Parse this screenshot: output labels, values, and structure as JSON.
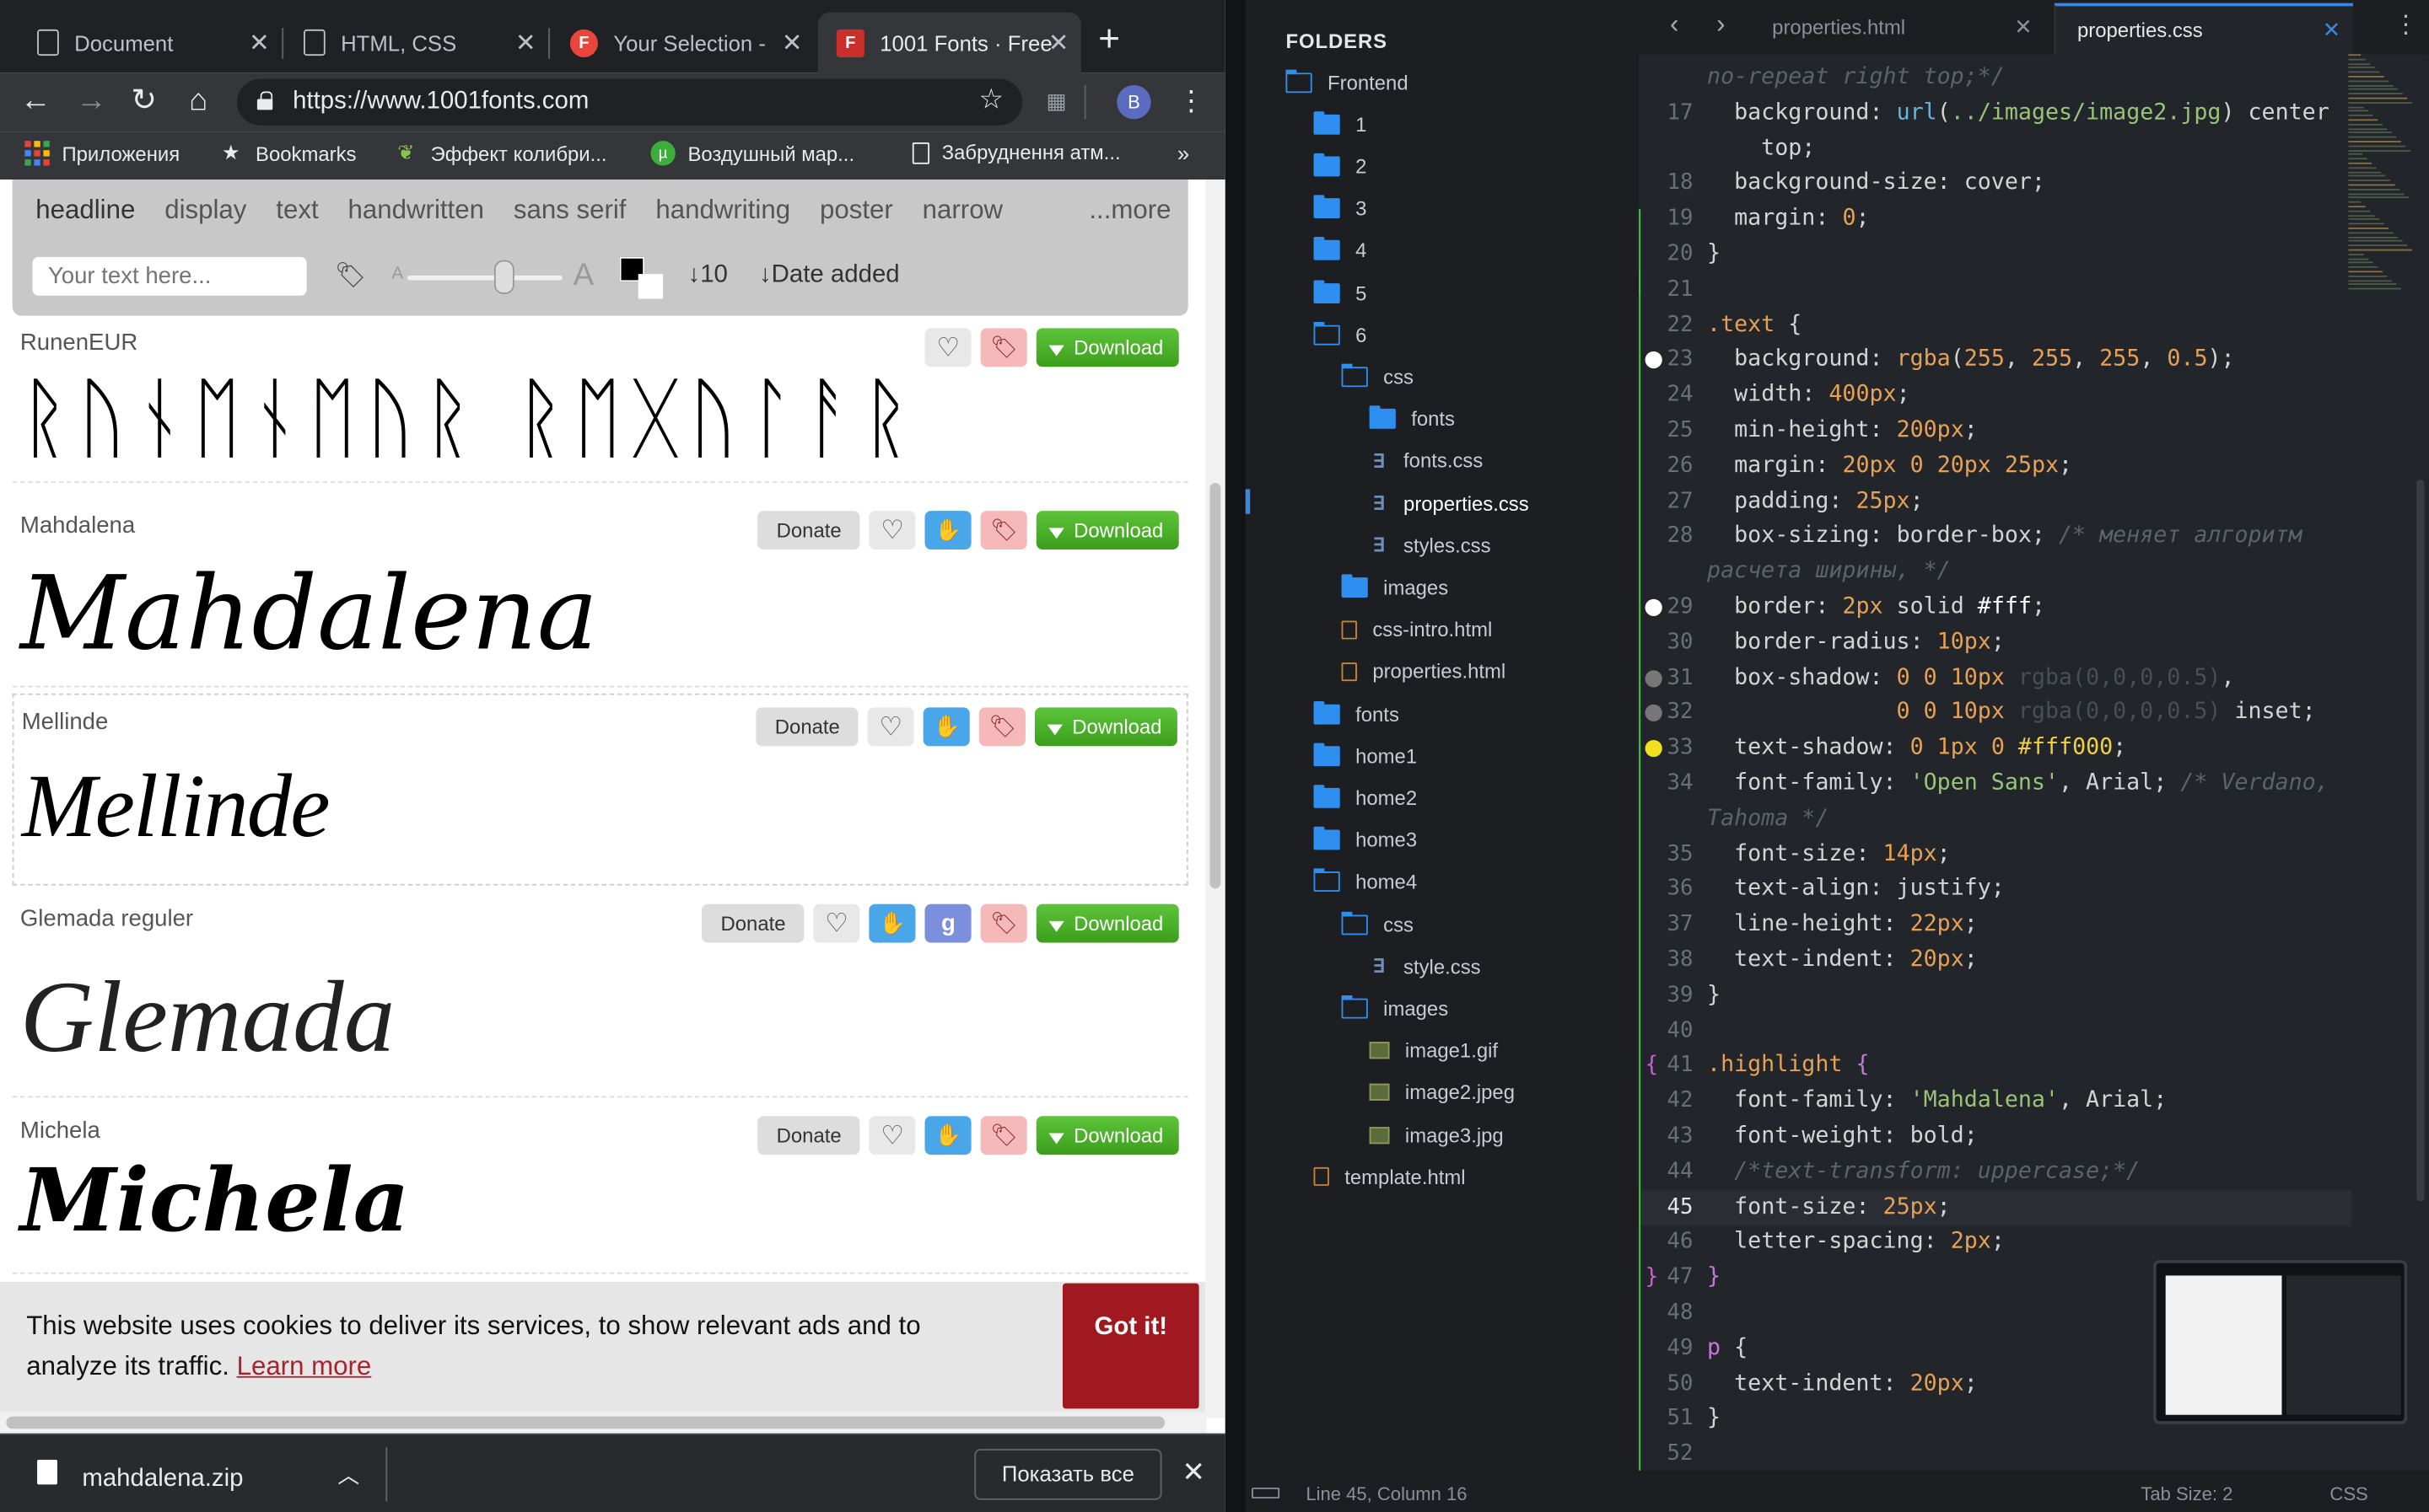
{
  "browser": {
    "tabs": [
      {
        "title": "Document",
        "icon": "doc"
      },
      {
        "title": "HTML, CSS",
        "icon": "doc"
      },
      {
        "title": "Your Selection -",
        "icon": "F"
      },
      {
        "title": "1001 Fonts · Free",
        "icon": "F"
      }
    ],
    "url": "https://www.1001fonts.com",
    "avatar": "B",
    "bookmarks": [
      "Приложения",
      "Bookmarks",
      "Эффект колибри...",
      "Воздушный мар...",
      "Забруднення атм..."
    ],
    "bookmarks_more": "»"
  },
  "page": {
    "categories": [
      "headline",
      "display",
      "text",
      "handwritten",
      "sans serif",
      "handwriting",
      "poster",
      "narrow"
    ],
    "more": "...more",
    "text_placeholder": "Your text here...",
    "size_small": "A",
    "size_large": "A",
    "slider_value": 0.62,
    "sort_count": "↓10",
    "sort_date": "↓Date added",
    "fonts": [
      {
        "name": "RunenEUR",
        "sample": "ᚱᚢᚾᛖᚾᛖᚢᚱ ᚱᛖᚷᚢᛚᚨᚱ",
        "donate": "",
        "download": "Download"
      },
      {
        "name": "Mahdalena",
        "sample": "Mahdalena",
        "donate": "Donate",
        "download": "Download"
      },
      {
        "name": "Mellinde",
        "sample": "Mellinde",
        "donate": "Donate",
        "download": "Download"
      },
      {
        "name": "Glemada reguler",
        "sample": "Glemada",
        "donate": "Donate",
        "download": "Download"
      },
      {
        "name": "Michela",
        "sample": "Michela",
        "donate": "Donate",
        "download": "Download"
      }
    ],
    "cookie_text": "This website uses cookies to deliver its services, to show relevant ads and to analyze its traffic.",
    "cookie_link": "Learn more",
    "cookie_button": "Got it!"
  },
  "downloads": {
    "file": "mahdalena.zip",
    "show_all": "Показать все"
  },
  "editor": {
    "folders_title": "FOLDERS",
    "tree": [
      {
        "label": "Frontend",
        "type": "folder-open",
        "indent": 0
      },
      {
        "label": "1",
        "type": "folder",
        "indent": 1
      },
      {
        "label": "2",
        "type": "folder",
        "indent": 1
      },
      {
        "label": "3",
        "type": "folder",
        "indent": 1
      },
      {
        "label": "4",
        "type": "folder",
        "indent": 1
      },
      {
        "label": "5",
        "type": "folder",
        "indent": 1
      },
      {
        "label": "6",
        "type": "folder-open",
        "indent": 1
      },
      {
        "label": "css",
        "type": "folder-open",
        "indent": 2
      },
      {
        "label": "fonts",
        "type": "folder",
        "indent": 3
      },
      {
        "label": "fonts.css",
        "type": "css",
        "indent": 3
      },
      {
        "label": "properties.css",
        "type": "css",
        "indent": 3,
        "selected": true
      },
      {
        "label": "styles.css",
        "type": "css",
        "indent": 3
      },
      {
        "label": "images",
        "type": "folder",
        "indent": 2
      },
      {
        "label": "css-intro.html",
        "type": "html",
        "indent": 2
      },
      {
        "label": "properties.html",
        "type": "html",
        "indent": 2
      },
      {
        "label": "fonts",
        "type": "folder",
        "indent": 1
      },
      {
        "label": "home1",
        "type": "folder",
        "indent": 1
      },
      {
        "label": "home2",
        "type": "folder",
        "indent": 1
      },
      {
        "label": "home3",
        "type": "folder",
        "indent": 1
      },
      {
        "label": "home4",
        "type": "folder-open",
        "indent": 1
      },
      {
        "label": "css",
        "type": "folder-open",
        "indent": 2
      },
      {
        "label": "style.css",
        "type": "css",
        "indent": 3
      },
      {
        "label": "images",
        "type": "folder-open",
        "indent": 2
      },
      {
        "label": "image1.gif",
        "type": "img",
        "indent": 3
      },
      {
        "label": "image2.jpeg",
        "type": "img",
        "indent": 3
      },
      {
        "label": "image3.jpg",
        "type": "img",
        "indent": 3
      },
      {
        "label": "template.html",
        "type": "html",
        "indent": 1
      }
    ],
    "tabs": [
      {
        "label": "properties.html",
        "active": false
      },
      {
        "label": "properties.css",
        "active": true
      }
    ],
    "status": {
      "position": "Line 45, Column 16",
      "tab_size": "Tab Size: 2",
      "syntax": "CSS"
    },
    "code": [
      {
        "n": "",
        "html": "<span class='cmt'>no-repeat right top;*/</span>"
      },
      {
        "n": "17",
        "html": "  <span class='prop'>background</span>: <span class='fn'>url</span>(<span class='str'>../images/image2.jpg</span>) center"
      },
      {
        "n": "",
        "html": "    top;"
      },
      {
        "n": "18",
        "html": "  <span class='prop'>background-size</span>: cover;"
      },
      {
        "n": "19",
        "html": "  <span class='prop'>margin</span>: <span class='num'>0</span>;"
      },
      {
        "n": "20",
        "html": "}"
      },
      {
        "n": "21",
        "html": ""
      },
      {
        "n": "22",
        "html": "<span class='cls'>.text</span> {"
      },
      {
        "n": "23",
        "html": "  <span class='prop'>background</span>: <span class='num'>rgba</span>(<span class='num'>255</span>, <span class='num'>255</span>, <span class='num'>255</span>, <span class='num'>0.5</span>);",
        "dot": "#ffffff"
      },
      {
        "n": "24",
        "html": "  <span class='prop'>width</span>: <span class='num'>400px</span>;"
      },
      {
        "n": "25",
        "html": "  <span class='prop'>min-height</span>: <span class='num'>200px</span>;"
      },
      {
        "n": "26",
        "html": "  <span class='prop'>margin</span>: <span class='num'>20px</span> <span class='num'>0</span> <span class='num'>20px</span> <span class='num'>25px</span>;"
      },
      {
        "n": "27",
        "html": "  <span class='prop'>padding</span>: <span class='num'>25px</span>;"
      },
      {
        "n": "28",
        "html": "  <span class='prop'>box-sizing</span>: border-box;  <span class='cmt'>/* меняет алгоритм</span>"
      },
      {
        "n": "",
        "html": "<span class='cmt'>расчета ширины, */</span>"
      },
      {
        "n": "29",
        "html": "  <span class='prop'>border</span>: <span class='num'>2px</span> solid <span class='wht'>#fff</span>;",
        "dot": "#ffffff"
      },
      {
        "n": "30",
        "html": "  <span class='prop'>border-radius</span>: <span class='num'>10px</span>;"
      },
      {
        "n": "31",
        "html": "  <span class='prop'>box-shadow</span>: <span class='num'>0</span> <span class='num'>0</span> <span class='num'>10px</span> <span class='faded'>rgba(0,0,0,0.5)</span>,",
        "dot": "#777777"
      },
      {
        "n": "32",
        "html": "              <span class='num'>0</span> <span class='num'>0</span> <span class='num'>10px</span> <span class='faded'>rgba(0,0,0,0.5)</span> inset;",
        "dot": "#777777"
      },
      {
        "n": "33",
        "html": "  <span class='prop'>text-shadow</span>: <span class='num'>0</span> <span class='num'>1px</span> <span class='num'>0</span> <span class='yel'>#fff000</span>;",
        "dot": "#f0e020"
      },
      {
        "n": "34",
        "html": "  <span class='prop'>font-family</span>: <span class='str'>'Open Sans'</span>, Arial; <span class='cmt'>/* Verdano,</span>"
      },
      {
        "n": "",
        "html": "<span class='cmt'>Tahoma */</span>"
      },
      {
        "n": "35",
        "html": "  <span class='prop'>font-size</span>: <span class='num'>14px</span>;"
      },
      {
        "n": "36",
        "html": "  <span class='prop'>text-align</span>: justify;"
      },
      {
        "n": "37",
        "html": "  <span class='prop'>line-height</span>: <span class='num'>22px</span>;"
      },
      {
        "n": "38",
        "html": "  <span class='prop'>text-indent</span>: <span class='num'>20px</span>;"
      },
      {
        "n": "39",
        "html": "}"
      },
      {
        "n": "40",
        "html": ""
      },
      {
        "n": "41",
        "html": "<span class='cls'>.highlight</span> <span class='kw'>{</span>",
        "brace": "{"
      },
      {
        "n": "42",
        "html": "  <span class='prop'>font-family</span>: <span class='str'>'Mahdalena'</span>, Arial;"
      },
      {
        "n": "43",
        "html": "  <span class='prop'>font-weight</span>: bold;"
      },
      {
        "n": "44",
        "html": "  <span class='cmt'>/*text-transform: uppercase;*/</span>"
      },
      {
        "n": "45",
        "html": "  <span class='prop'>font-size</span>: <span class='num'>25px</span>;",
        "current": true
      },
      {
        "n": "46",
        "html": "  <span class='prop'>letter-spacing</span>: <span class='num'>2px</span>;"
      },
      {
        "n": "47",
        "html": "<span class='kw'>}</span>",
        "brace": "}"
      },
      {
        "n": "48",
        "html": ""
      },
      {
        "n": "49",
        "html": "<span class='kw'>p</span> {"
      },
      {
        "n": "50",
        "html": "  <span class='prop'>text-indent</span>: <span class='num'>20px</span>;"
      },
      {
        "n": "51",
        "html": "}"
      },
      {
        "n": "52",
        "html": ""
      }
    ]
  }
}
